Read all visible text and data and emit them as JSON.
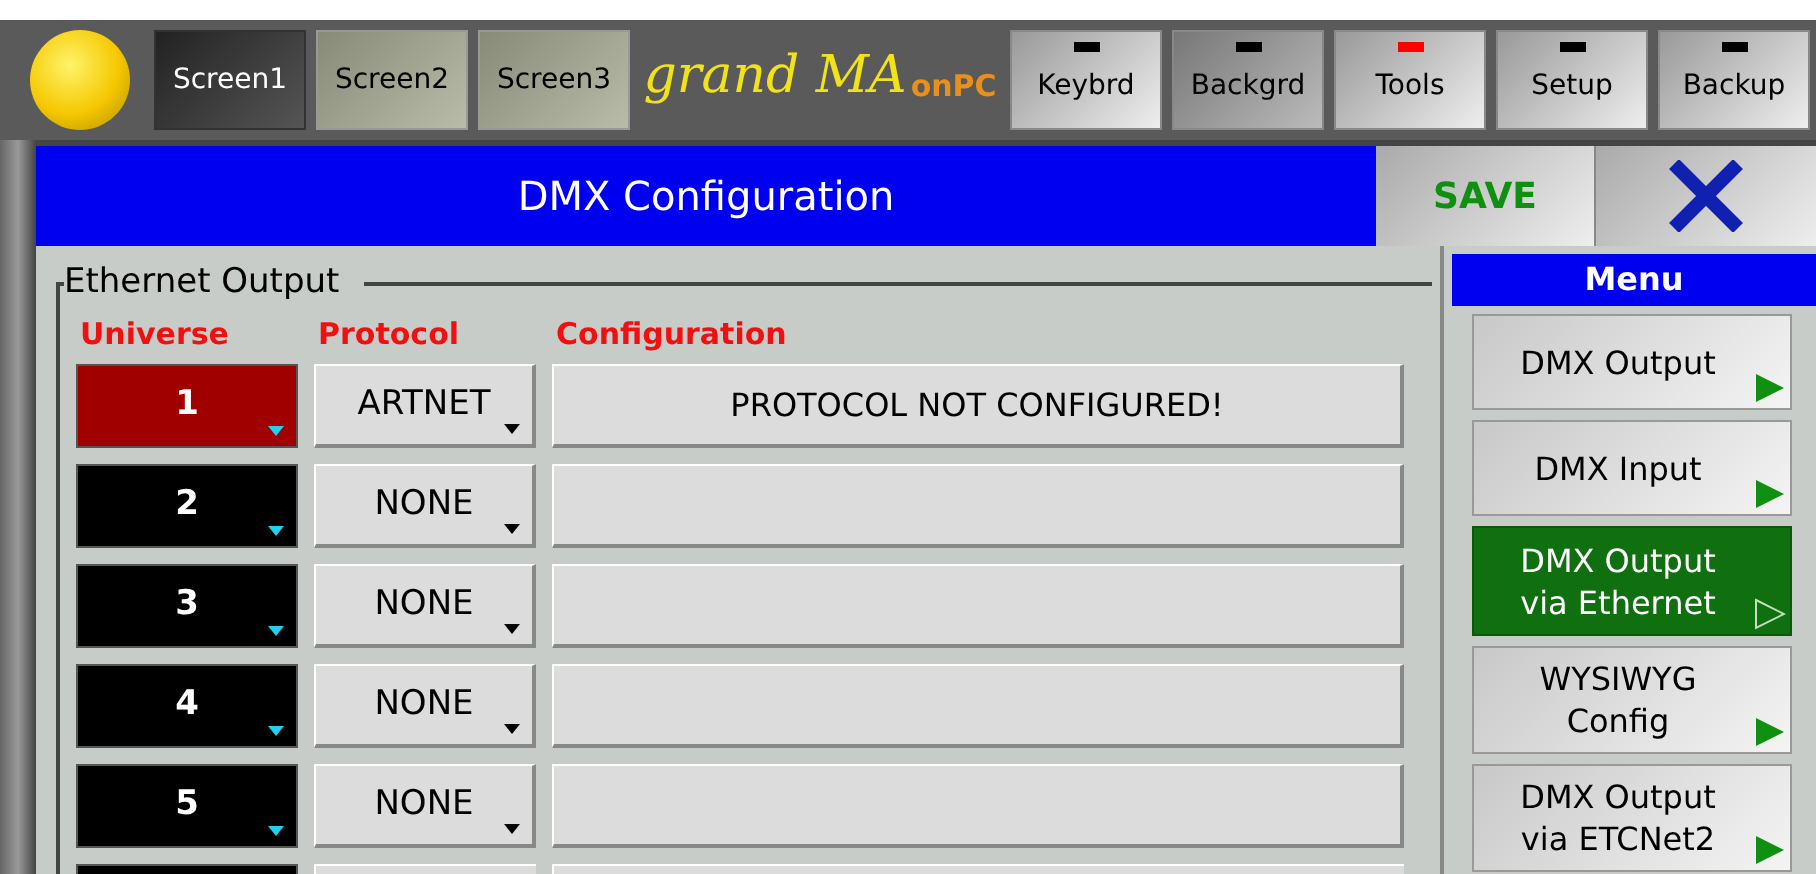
{
  "top_bar": {
    "screens": [
      {
        "label": "Screen1",
        "selected": true
      },
      {
        "label": "Screen2",
        "selected": false
      },
      {
        "label": "Screen3",
        "selected": false
      }
    ],
    "logo": {
      "text": "grand MA",
      "suffix": "onPC"
    },
    "buttons": [
      {
        "label": "Keybrd",
        "indicator_on": false,
        "pressed": false
      },
      {
        "label": "Backgrd",
        "indicator_on": false,
        "pressed": true
      },
      {
        "label": "Tools",
        "indicator_on": true,
        "pressed": false
      },
      {
        "label": "Setup",
        "indicator_on": false,
        "pressed": false
      },
      {
        "label": "Backup",
        "indicator_on": false,
        "pressed": false
      }
    ]
  },
  "dialog": {
    "title": "DMX Configuration",
    "save": "SAVE"
  },
  "section": {
    "legend": "Ethernet Output",
    "columns": [
      "Universe",
      "Protocol",
      "Configuration"
    ],
    "rows": [
      {
        "universe": "1",
        "selected": true,
        "protocol": "ARTNET",
        "configuration": "PROTOCOL NOT CONFIGURED!"
      },
      {
        "universe": "2",
        "selected": false,
        "protocol": "NONE"
      },
      {
        "universe": "3",
        "selected": false,
        "protocol": "NONE"
      },
      {
        "universe": "4",
        "selected": false,
        "protocol": "NONE"
      },
      {
        "universe": "5",
        "selected": false,
        "protocol": "NONE"
      }
    ]
  },
  "menu": {
    "title": "Menu",
    "items": [
      {
        "label": "DMX Output",
        "selected": false
      },
      {
        "label": "DMX Input",
        "selected": false
      },
      {
        "label": "DMX Output\nvia Ethernet",
        "selected": true
      },
      {
        "label": "WYSIWYG\nConfig",
        "selected": false
      },
      {
        "label": "DMX Output\nvia ETCNet2",
        "selected": false
      }
    ]
  }
}
